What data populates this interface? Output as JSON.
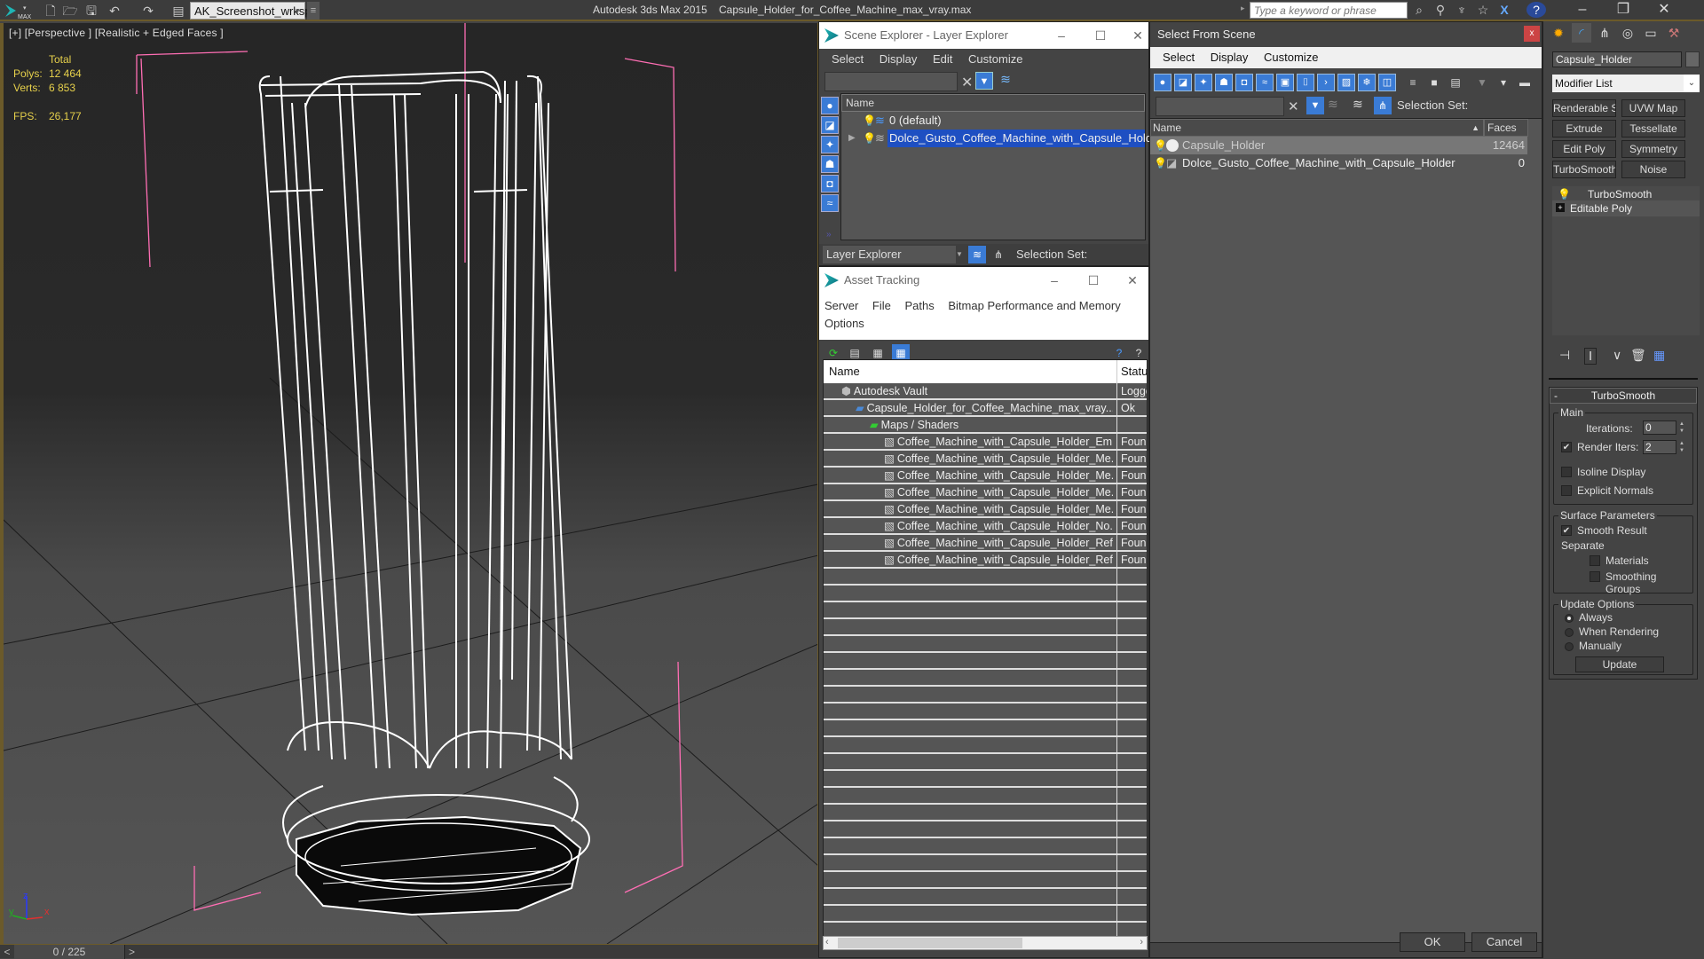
{
  "app": {
    "title": "Autodesk 3ds Max  2015",
    "file": "Capsule_Holder_for_Coffee_Machine_max_vray.max",
    "workspace": "AK_Screenshot_wrksp",
    "search_placeholder": "Type a keyword or phrase",
    "window_controls": {
      "minimize": "–",
      "restore": "❐",
      "close": "✕"
    }
  },
  "viewport": {
    "label": "[+] [Perspective ] [Realistic + Edged Faces ]",
    "stats": {
      "total_label": "Total",
      "polys_label": "Polys:",
      "polys": "12 464",
      "verts_label": "Verts:",
      "verts": "6 853",
      "fps_label": "FPS:",
      "fps": "26,177"
    },
    "axis": {
      "x": "x",
      "y": "y",
      "z": "z"
    }
  },
  "timeline": {
    "frame": "0 / 225",
    "prev": "<",
    "next": ">"
  },
  "scene_explorer": {
    "title": "Scene Explorer - Layer Explorer",
    "menu": [
      "Select",
      "Display",
      "Edit",
      "Customize"
    ],
    "column": "Name",
    "rows": [
      {
        "name": "0 (default)",
        "selected": false
      },
      {
        "name": "Dolce_Gusto_Coffee_Machine_with_Capsule_Holder",
        "selected": true
      }
    ],
    "mode": "Layer Explorer",
    "selection_set_label": "Selection Set:"
  },
  "asset_tracking": {
    "title": "Asset Tracking",
    "menu": [
      "Server",
      "File",
      "Paths",
      "Bitmap Performance and Memory",
      "Options"
    ],
    "columns": {
      "name": "Name",
      "status": "Status"
    },
    "rows": [
      {
        "name": "Autodesk Vault",
        "status": "Logged",
        "indent": 0,
        "icon": "vault-icon"
      },
      {
        "name": "Capsule_Holder_for_Coffee_Machine_max_vray....",
        "status": "Ok",
        "indent": 1,
        "icon": "max-file-icon"
      },
      {
        "name": "Maps / Shaders",
        "status": "",
        "indent": 2,
        "icon": "maps-icon"
      },
      {
        "name": "Coffee_Machine_with_Capsule_Holder_Em...",
        "status": "Found",
        "indent": 3,
        "icon": "bitmap-icon"
      },
      {
        "name": "Coffee_Machine_with_Capsule_Holder_Me...",
        "status": "Found",
        "indent": 3,
        "icon": "bitmap-icon"
      },
      {
        "name": "Coffee_Machine_with_Capsule_Holder_Me...",
        "status": "Found",
        "indent": 3,
        "icon": "bitmap-icon"
      },
      {
        "name": "Coffee_Machine_with_Capsule_Holder_Me...",
        "status": "Found",
        "indent": 3,
        "icon": "bitmap-icon"
      },
      {
        "name": "Coffee_Machine_with_Capsule_Holder_Me...",
        "status": "Found",
        "indent": 3,
        "icon": "bitmap-icon"
      },
      {
        "name": "Coffee_Machine_with_Capsule_Holder_No...",
        "status": "Found",
        "indent": 3,
        "icon": "bitmap-icon"
      },
      {
        "name": "Coffee_Machine_with_Capsule_Holder_Ref...",
        "status": "Found",
        "indent": 3,
        "icon": "bitmap-icon"
      },
      {
        "name": "Coffee_Machine_with_Capsule_Holder_Ref...",
        "status": "Found",
        "indent": 3,
        "icon": "bitmap-icon"
      }
    ]
  },
  "select_from_scene": {
    "title": "Select From Scene",
    "close": "x",
    "menu": [
      "Select",
      "Display",
      "Customize"
    ],
    "selection_set_label": "Selection Set:",
    "columns": {
      "name": "Name",
      "faces": "Faces"
    },
    "rows": [
      {
        "name": "Capsule_Holder",
        "faces": "12464",
        "selected": true
      },
      {
        "name": "Dolce_Gusto_Coffee_Machine_with_Capsule_Holder",
        "faces": "0",
        "selected": false
      }
    ],
    "ok": "OK",
    "cancel": "Cancel"
  },
  "command_panel": {
    "object_name": "Capsule_Holder",
    "modifier_list": "Modifier List",
    "modifier_buttons": [
      "Renderable Spline",
      "UVW Map",
      "Extrude",
      "Tessellate",
      "Edit Poly",
      "Symmetry",
      "TurboSmooth",
      "Noise"
    ],
    "stack": [
      "TurboSmooth",
      "Editable Poly"
    ],
    "rollout": {
      "title": "TurboSmooth",
      "collapse": "-",
      "main_label": "Main",
      "iterations_label": "Iterations:",
      "iterations": "0",
      "render_iters_label": "Render Iters:",
      "render_iters": "2",
      "render_iters_checked": true,
      "isoline_label": "Isoline Display",
      "isoline_checked": false,
      "explicit_normals_label": "Explicit Normals",
      "explicit_normals_checked": false,
      "surface_label": "Surface Parameters",
      "smooth_result_label": "Smooth Result",
      "smooth_result_checked": true,
      "separate_label": "Separate",
      "materials_label": "Materials",
      "smoothing_groups_label": "Smoothing Groups",
      "update_label": "Update Options",
      "always_label": "Always",
      "when_rendering_label": "When Rendering",
      "manually_label": "Manually",
      "update_selected": "Always",
      "update_button": "Update"
    }
  },
  "colors": {
    "accent_blue": "#3a7bd5",
    "selection_blue": "#1e4fc2",
    "stats_yellow": "#e6d04b",
    "viewport_border": "#6b5a2a",
    "gizmo_pink": "#ff6eb4"
  }
}
